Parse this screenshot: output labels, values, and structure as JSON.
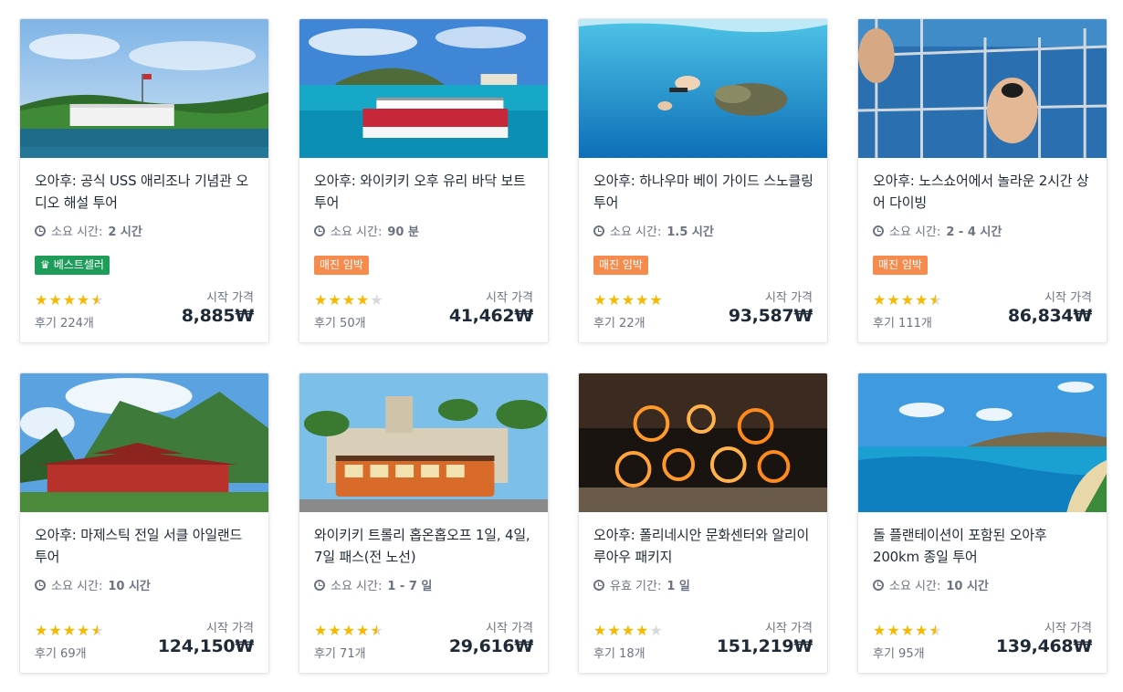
{
  "currency": "₩",
  "cards": [
    {
      "title": "오아후: 공식 USS 애리조나 기념관 오디오 해설 투어",
      "duration_label": "소요 시간:",
      "duration": "2 시간",
      "badge": "베스트셀러",
      "badge_type": "bestseller",
      "rating": 4.5,
      "reviews": "후기 224개",
      "price_label": "시작 가격",
      "price": "8,885₩",
      "image": "pearl-harbor-memorial"
    },
    {
      "title": "오아후: 와이키키 오후 유리 바닥 보트 투어",
      "duration_label": "소요 시간:",
      "duration": "90 분",
      "badge": "매진 임박",
      "badge_type": "soldout",
      "rating": 4,
      "reviews": "후기 50개",
      "price_label": "시작 가격",
      "price": "41,462₩",
      "image": "glass-bottom-boat"
    },
    {
      "title": "오아후: 하나우마 베이 가이드 스노클링 투어",
      "duration_label": "소요 시간:",
      "duration": "1.5 시간",
      "badge": "매진 임박",
      "badge_type": "soldout",
      "rating": 5,
      "reviews": "후기 22개",
      "price_label": "시작 가격",
      "price": "93,587₩",
      "image": "sea-turtle-snorkel"
    },
    {
      "title": "오아후: 노스쇼어에서 놀라운 2시간 상어 다이빙",
      "duration_label": "소요 시간:",
      "duration": "2 - 4 시간",
      "badge": "매진 임박",
      "badge_type": "soldout",
      "rating": 4.5,
      "reviews": "후기 111개",
      "price_label": "시작 가격",
      "price": "86,834₩",
      "image": "shark-cage"
    },
    {
      "title": "오아후: 마제스틱 전일 서클 아일랜드 투어",
      "duration_label": "소요 시간:",
      "duration": "10 시간",
      "badge": "",
      "badge_type": "",
      "rating": 4.5,
      "reviews": "후기 69개",
      "price_label": "시작 가격",
      "price": "124,150₩",
      "image": "byodo-in-temple"
    },
    {
      "title": "와이키키 트롤리 홉온홉오프 1일, 4일, 7일 패스(전 노선)",
      "duration_label": "소요 시간:",
      "duration": "1 - 7 일",
      "badge": "",
      "badge_type": "",
      "rating": 4.5,
      "reviews": "후기 71개",
      "price_label": "시작 가격",
      "price": "29,616₩",
      "image": "waikiki-trolley"
    },
    {
      "title": "오아후: 폴리네시안 문화센터와 알리이 루아우 패키지",
      "duration_label": "유효 기간:",
      "duration": "1 일",
      "badge": "",
      "badge_type": "",
      "rating": 4,
      "reviews": "후기 18개",
      "price_label": "시작 가격",
      "price": "151,219₩",
      "image": "fire-dancers"
    },
    {
      "title": "돌 플랜테이션이 포함된 오아후 200km 종일 투어",
      "duration_label": "소요 시간:",
      "duration": "10 시간",
      "badge": "",
      "badge_type": "",
      "rating": 4.5,
      "reviews": "후기 95개",
      "price_label": "시작 가격",
      "price": "139,468₩",
      "image": "hanauma-bay-coast"
    }
  ],
  "icons": {
    "clock": "clock-icon",
    "crown": "crown-icon",
    "star": "star-icon"
  },
  "colors": {
    "bestseller": "#1e9d5a",
    "soldout": "#f58b4c",
    "star": "#f6b800"
  }
}
